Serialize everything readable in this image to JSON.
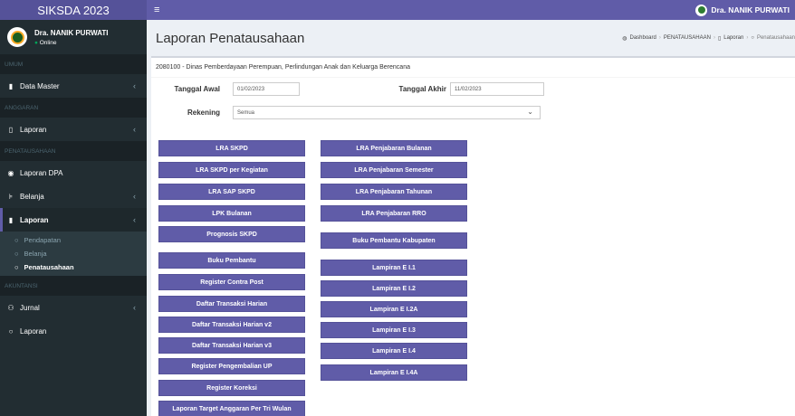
{
  "app": {
    "title": "SIKSDA 2023"
  },
  "navbar": {
    "menu_icon": "bars-icon",
    "user_name": "Dra. NANIK PURWATI"
  },
  "sidebar": {
    "user": {
      "name": "Dra. NANIK PURWATI",
      "status": "Online"
    },
    "headers": [
      "UMUM",
      "ANGGARAN",
      "PENATAUSAHAAN",
      "AKUNTANSI"
    ],
    "items": {
      "data_master": "Data Master",
      "laporan_anggaran": "Laporan",
      "laporan_dpa": "Laporan DPA",
      "belanja": "Belanja",
      "laporan_penatausahaan": "Laporan",
      "jurnal": "Jurnal",
      "laporan_akuntansi": "Laporan"
    },
    "sub_items": [
      "Pendapatan",
      "Belanja",
      "Penatausahaan"
    ]
  },
  "page": {
    "title": "Laporan Penatausahaan",
    "breadcrumb": [
      "Dashboard",
      "PENATAUSAHAAN",
      "Laporan",
      "Penatausahaan"
    ]
  },
  "box": {
    "title": "2080100 - Dinas Pemberdayaan Perempuan, Perlindungan Anak dan Keluarga Berencana"
  },
  "form": {
    "tanggal_awal_label": "Tanggal Awal",
    "tanggal_awal_value": "01/02/2023",
    "tanggal_akhir_label": "Tanggal Akhir",
    "tanggal_akhir_value": "11/02/2023",
    "rekening_label": "Rekening",
    "rekening_value": "Semua"
  },
  "buttons_left": [
    "LRA SKPD",
    "LRA SKPD per Kegiatan",
    "LRA SAP SKPD",
    "LPK Bulanan",
    "Prognosis SKPD",
    "Buku Pembantu",
    "Register Contra Post",
    "Daftar Transaksi Harian",
    "Daftar Transaksi Harian v2",
    "Daftar Transaksi Harian v3",
    "Register Pengembalian UP",
    "Register Koreksi",
    "Laporan Target Anggaran Per Tri Wulan"
  ],
  "buttons_right": [
    "LRA Penjabaran Bulanan",
    "LRA Penjabaran Semester",
    "LRA Penjabaran Tahunan",
    "LRA Penjabaran RRO",
    "Buku Pembantu Kabupaten",
    "Lampiran E I.1",
    "Lampiran E I.2",
    "Lampiran E I.2A",
    "Lampiran E I.3",
    "Lampiran E I.4",
    "Lampiran E I.4A"
  ],
  "colors": {
    "primary": "#605ca8",
    "sidebar": "#222d32"
  }
}
